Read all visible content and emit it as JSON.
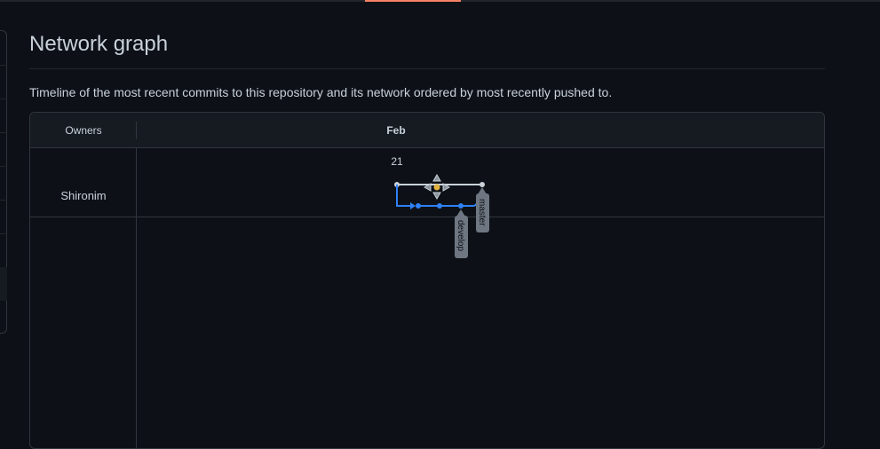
{
  "page": {
    "title": "Network graph",
    "description": "Timeline of the most recent commits to this repository and its network ordered by most recently pushed to."
  },
  "graph": {
    "owners_header": "Owners",
    "month": "Feb",
    "day": "21",
    "owners": [
      "Shironim"
    ],
    "branches": [
      "master",
      "develop"
    ]
  },
  "colors": {
    "background": "#0d1117",
    "border": "#30363d",
    "tab_indicator": "#f78166",
    "master_line": "#c9d1d9",
    "develop_line": "#2f81f7",
    "branch_label_bg": "#6e7681",
    "nav_arrow_center": "#e3b341"
  },
  "icons": [
    "pan-arrows-icon"
  ]
}
